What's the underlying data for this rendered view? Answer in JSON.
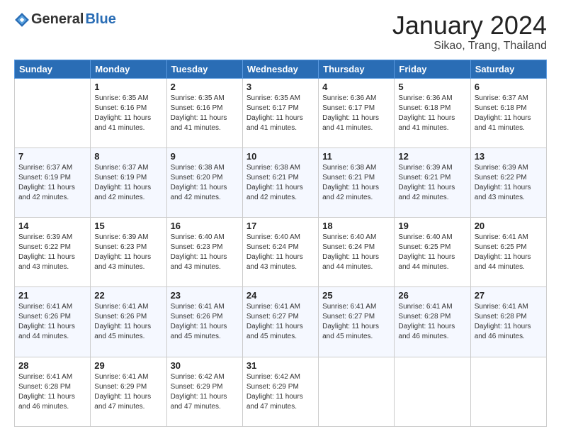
{
  "header": {
    "logo": {
      "text_general": "General",
      "text_blue": "Blue",
      "tagline": ""
    },
    "title": "January 2024",
    "location": "Sikao, Trang, Thailand"
  },
  "columns": [
    "Sunday",
    "Monday",
    "Tuesday",
    "Wednesday",
    "Thursday",
    "Friday",
    "Saturday"
  ],
  "weeks": [
    [
      {
        "day": "",
        "sunrise": "",
        "sunset": "",
        "daylight": ""
      },
      {
        "day": "1",
        "sunrise": "6:35 AM",
        "sunset": "6:16 PM",
        "daylight": "11 hours and 41 minutes."
      },
      {
        "day": "2",
        "sunrise": "6:35 AM",
        "sunset": "6:16 PM",
        "daylight": "11 hours and 41 minutes."
      },
      {
        "day": "3",
        "sunrise": "6:35 AM",
        "sunset": "6:17 PM",
        "daylight": "11 hours and 41 minutes."
      },
      {
        "day": "4",
        "sunrise": "6:36 AM",
        "sunset": "6:17 PM",
        "daylight": "11 hours and 41 minutes."
      },
      {
        "day": "5",
        "sunrise": "6:36 AM",
        "sunset": "6:18 PM",
        "daylight": "11 hours and 41 minutes."
      },
      {
        "day": "6",
        "sunrise": "6:37 AM",
        "sunset": "6:18 PM",
        "daylight": "11 hours and 41 minutes."
      }
    ],
    [
      {
        "day": "7",
        "sunrise": "6:37 AM",
        "sunset": "6:19 PM",
        "daylight": "11 hours and 42 minutes."
      },
      {
        "day": "8",
        "sunrise": "6:37 AM",
        "sunset": "6:19 PM",
        "daylight": "11 hours and 42 minutes."
      },
      {
        "day": "9",
        "sunrise": "6:38 AM",
        "sunset": "6:20 PM",
        "daylight": "11 hours and 42 minutes."
      },
      {
        "day": "10",
        "sunrise": "6:38 AM",
        "sunset": "6:21 PM",
        "daylight": "11 hours and 42 minutes."
      },
      {
        "day": "11",
        "sunrise": "6:38 AM",
        "sunset": "6:21 PM",
        "daylight": "11 hours and 42 minutes."
      },
      {
        "day": "12",
        "sunrise": "6:39 AM",
        "sunset": "6:21 PM",
        "daylight": "11 hours and 42 minutes."
      },
      {
        "day": "13",
        "sunrise": "6:39 AM",
        "sunset": "6:22 PM",
        "daylight": "11 hours and 43 minutes."
      }
    ],
    [
      {
        "day": "14",
        "sunrise": "6:39 AM",
        "sunset": "6:22 PM",
        "daylight": "11 hours and 43 minutes."
      },
      {
        "day": "15",
        "sunrise": "6:39 AM",
        "sunset": "6:23 PM",
        "daylight": "11 hours and 43 minutes."
      },
      {
        "day": "16",
        "sunrise": "6:40 AM",
        "sunset": "6:23 PM",
        "daylight": "11 hours and 43 minutes."
      },
      {
        "day": "17",
        "sunrise": "6:40 AM",
        "sunset": "6:24 PM",
        "daylight": "11 hours and 43 minutes."
      },
      {
        "day": "18",
        "sunrise": "6:40 AM",
        "sunset": "6:24 PM",
        "daylight": "11 hours and 44 minutes."
      },
      {
        "day": "19",
        "sunrise": "6:40 AM",
        "sunset": "6:25 PM",
        "daylight": "11 hours and 44 minutes."
      },
      {
        "day": "20",
        "sunrise": "6:41 AM",
        "sunset": "6:25 PM",
        "daylight": "11 hours and 44 minutes."
      }
    ],
    [
      {
        "day": "21",
        "sunrise": "6:41 AM",
        "sunset": "6:26 PM",
        "daylight": "11 hours and 44 minutes."
      },
      {
        "day": "22",
        "sunrise": "6:41 AM",
        "sunset": "6:26 PM",
        "daylight": "11 hours and 45 minutes."
      },
      {
        "day": "23",
        "sunrise": "6:41 AM",
        "sunset": "6:26 PM",
        "daylight": "11 hours and 45 minutes."
      },
      {
        "day": "24",
        "sunrise": "6:41 AM",
        "sunset": "6:27 PM",
        "daylight": "11 hours and 45 minutes."
      },
      {
        "day": "25",
        "sunrise": "6:41 AM",
        "sunset": "6:27 PM",
        "daylight": "11 hours and 45 minutes."
      },
      {
        "day": "26",
        "sunrise": "6:41 AM",
        "sunset": "6:28 PM",
        "daylight": "11 hours and 46 minutes."
      },
      {
        "day": "27",
        "sunrise": "6:41 AM",
        "sunset": "6:28 PM",
        "daylight": "11 hours and 46 minutes."
      }
    ],
    [
      {
        "day": "28",
        "sunrise": "6:41 AM",
        "sunset": "6:28 PM",
        "daylight": "11 hours and 46 minutes."
      },
      {
        "day": "29",
        "sunrise": "6:41 AM",
        "sunset": "6:29 PM",
        "daylight": "11 hours and 47 minutes."
      },
      {
        "day": "30",
        "sunrise": "6:42 AM",
        "sunset": "6:29 PM",
        "daylight": "11 hours and 47 minutes."
      },
      {
        "day": "31",
        "sunrise": "6:42 AM",
        "sunset": "6:29 PM",
        "daylight": "11 hours and 47 minutes."
      },
      {
        "day": "",
        "sunrise": "",
        "sunset": "",
        "daylight": ""
      },
      {
        "day": "",
        "sunrise": "",
        "sunset": "",
        "daylight": ""
      },
      {
        "day": "",
        "sunrise": "",
        "sunset": "",
        "daylight": ""
      }
    ]
  ]
}
